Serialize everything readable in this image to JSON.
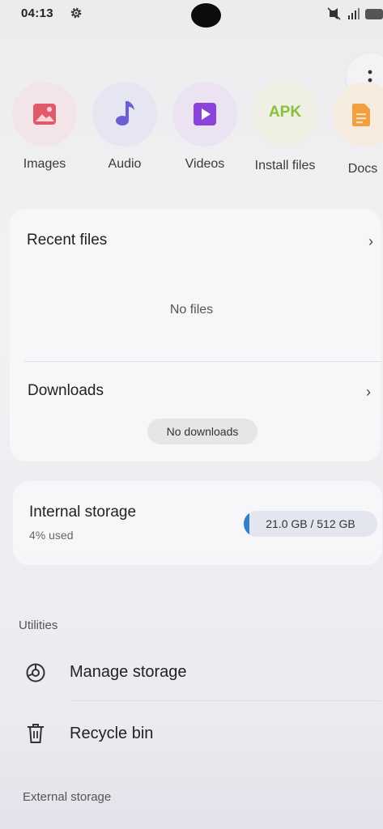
{
  "status_bar": {
    "time": "04:13",
    "icons": [
      "settings-icon",
      "mute-icon",
      "wifi-icon",
      "signal-icon",
      "battery-icon"
    ]
  },
  "categories": [
    {
      "label": "Images",
      "icon": "image-icon",
      "color": "#e05a6a"
    },
    {
      "label": "Audio",
      "icon": "music-note-icon",
      "color": "#6b5fd6"
    },
    {
      "label": "Videos",
      "icon": "video-play-icon",
      "color": "#8a44d9"
    },
    {
      "label": "Install files",
      "icon_text": "APK",
      "color": "#8bbf3c"
    },
    {
      "label": "Docs",
      "icon": "document-icon",
      "color": "#f0a040"
    }
  ],
  "recent": {
    "title": "Recent files",
    "empty": "No files"
  },
  "downloads": {
    "title": "Downloads",
    "empty": "No downloads"
  },
  "storage": {
    "title": "Internal storage",
    "percent_used": "4% used",
    "used_fraction": 0.04,
    "usage": "21.0 GB  / 512 GB",
    "accent": "#2f7fc9"
  },
  "utilities": {
    "header": "Utilities",
    "items": [
      {
        "label": "Manage storage",
        "icon": "storage-analysis-icon"
      },
      {
        "label": "Recycle bin",
        "icon": "trash-icon"
      }
    ]
  },
  "external": {
    "header": "External storage"
  }
}
